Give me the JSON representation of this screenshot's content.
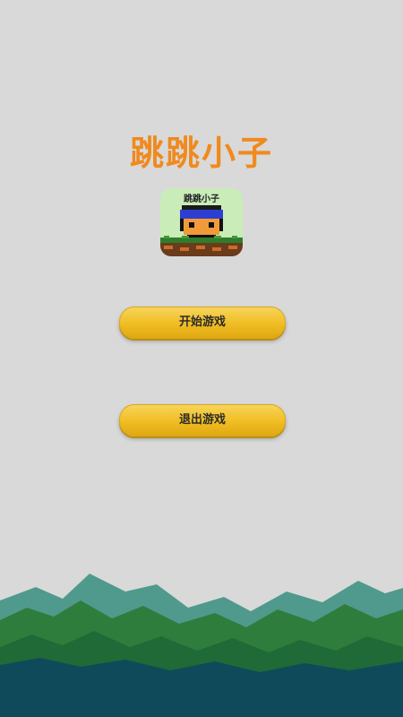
{
  "game": {
    "title": "跳跳小子",
    "logo_text": "跳跳小子"
  },
  "menu": {
    "start_label": "开始游戏",
    "exit_label": "退出游戏"
  },
  "colors": {
    "background": "#d9d9d9",
    "title": "#f08a1e",
    "button": "#f0bd22"
  }
}
